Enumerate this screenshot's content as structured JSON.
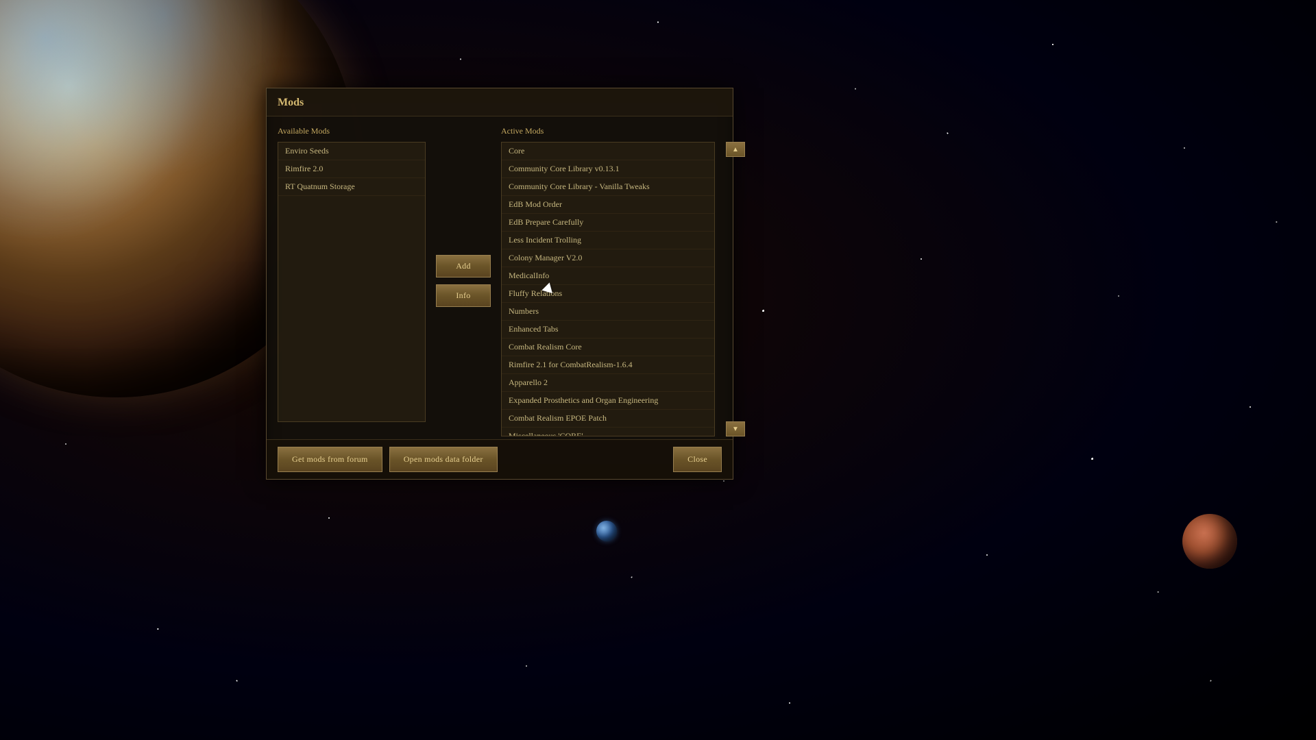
{
  "dialog": {
    "title": "Mods",
    "available_label": "Available Mods",
    "active_label": "Active Mods"
  },
  "available_mods": [
    {
      "id": "enviro-seeds",
      "name": "Enviro Seeds"
    },
    {
      "id": "rimfire-20",
      "name": "Rimfire 2.0"
    },
    {
      "id": "rt-quatnum",
      "name": "RT Quatnum Storage"
    }
  ],
  "active_mods": [
    {
      "id": "core",
      "name": "Core"
    },
    {
      "id": "ccl-0131",
      "name": "Community Core Library v0.13.1"
    },
    {
      "id": "ccl-vanilla",
      "name": "Community Core Library - Vanilla Tweaks"
    },
    {
      "id": "edb-mod-order",
      "name": "EdB Mod Order"
    },
    {
      "id": "edb-prepare",
      "name": "EdB Prepare Carefully"
    },
    {
      "id": "less-incident",
      "name": "Less Incident Trolling"
    },
    {
      "id": "colony-mgr",
      "name": "Colony Manager V2.0"
    },
    {
      "id": "medicalinfo",
      "name": "MedicalInfo"
    },
    {
      "id": "fluffy-relations",
      "name": "Fluffy Relations"
    },
    {
      "id": "numbers",
      "name": "Numbers"
    },
    {
      "id": "enhanced-tabs",
      "name": "Enhanced Tabs"
    },
    {
      "id": "combat-realism-core",
      "name": "Combat Realism Core"
    },
    {
      "id": "rimfire-21",
      "name": "Rimfire 2.1 for CombatRealism-1.6.4"
    },
    {
      "id": "apparello-2",
      "name": "Apparello 2"
    },
    {
      "id": "epoe",
      "name": "Expanded Prosthetics and Organ Engineering"
    },
    {
      "id": "cr-epoe-patch",
      "name": "Combat Realism EPOE Patch"
    },
    {
      "id": "misc-core",
      "name": "Miscellaneous 'CORE'"
    }
  ],
  "buttons": {
    "add": "Add",
    "info": "Info",
    "get_mods_forum": "Get mods from forum",
    "open_mods_folder": "Open mods data folder",
    "close": "Close"
  },
  "scroll": {
    "up_arrow": "▲",
    "down_arrow": "▼"
  }
}
